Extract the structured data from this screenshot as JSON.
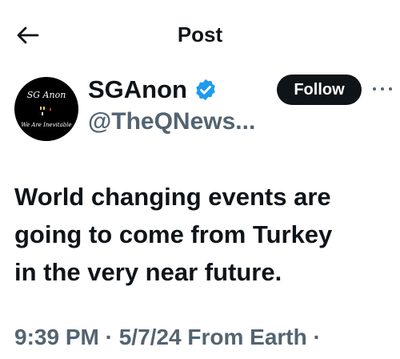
{
  "header": {
    "title": "Post",
    "back_icon": "arrow-left-icon"
  },
  "author": {
    "display_name": "SGAnon",
    "handle": "@TheQNews...",
    "verified": true,
    "verified_color": "#1d9bf0",
    "avatar_text_top": "SG Anon",
    "avatar_text_bottom": "We Are Inevitable"
  },
  "actions": {
    "follow_label": "Follow",
    "more_icon": "more-horizontal-icon"
  },
  "tweet": {
    "text": "World changing events are\ngoing to come from Turkey\nin the very near future."
  },
  "meta": {
    "time": "9:39 PM",
    "separator": " · ",
    "date": "5/7/24",
    "source": "From Earth",
    "trailing": " ·"
  },
  "colors": {
    "text": "#0f1419",
    "secondary": "#536471",
    "button_bg": "#0f1419"
  }
}
